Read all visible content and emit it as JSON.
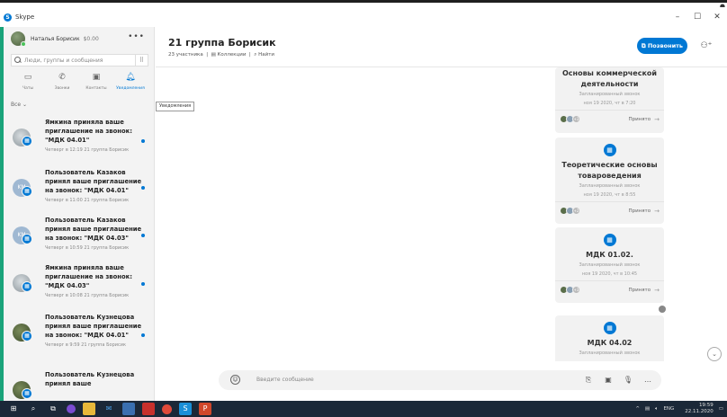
{
  "window": {
    "title": "Skype"
  },
  "profile": {
    "name": "Наталья Борисик",
    "balance": "$0.00"
  },
  "search": {
    "placeholder": "Люди, группы и сообщения"
  },
  "nav": [
    {
      "label": "Чаты",
      "icon": "chat-icon"
    },
    {
      "label": "Звонки",
      "icon": "phone-icon"
    },
    {
      "label": "Контакты",
      "icon": "contacts-icon"
    },
    {
      "label": "Уведомления",
      "icon": "bell-icon"
    }
  ],
  "filter": {
    "label": "Все"
  },
  "tooltip": "Уведомления",
  "notifications": [
    {
      "text": "Ямкина приняла ваше приглашение на звонок: \"МДК 04.01\"",
      "meta": "Четверг в 12:19  21 группа Борисик"
    },
    {
      "text": "Пользователь Казаков принял ваше приглашение на звонок: \"МДК 04.01\"",
      "meta": "Четверг в 11:00  21 группа Борисик",
      "initials": "KM"
    },
    {
      "text": "Пользователь Казаков принял ваше приглашение на звонок: \"МДК 04.03\"",
      "meta": "Четверг в 10:59  21 группа Борисик",
      "initials": "KM"
    },
    {
      "text": "Ямкина приняла ваше приглашение на звонок: \"МДК 04.03\"",
      "meta": "Четверг в 10:08  21 группа Борисик"
    },
    {
      "text": "Пользователь Кузнецова принял ваше приглашение на звонок: \"МДК 04.01\"",
      "meta": "Четверг в 9:59  21 группа Борисик"
    },
    {
      "text": "Пользователь Кузнецова принял ваше"
    }
  ],
  "chat": {
    "title": "21 группа Борисик",
    "participants": "23 участника",
    "collection": "Коллекции",
    "find": "Найти",
    "call_button": "Позвонить"
  },
  "cards": [
    {
      "title": "Основы коммерческой деятельности",
      "subtitle": "Запланированный звонок",
      "date": "ноя 19 2020, чт в 7:20",
      "count": "+3",
      "accepted": "Принято"
    },
    {
      "title": "Теоретические основы товароведения",
      "subtitle": "Запланированный звонок",
      "date": "ноя 19 2020, чт в 8:55",
      "count": "+2",
      "accepted": "Принято"
    },
    {
      "title": "МДК 01.02.",
      "subtitle": "Запланированный звонок",
      "date": "ноя 19 2020, чт в 10:45",
      "count": "+3",
      "accepted": "Принято"
    },
    {
      "title": "МДК 04.02",
      "subtitle": "Запланированный звонок"
    }
  ],
  "composer": {
    "placeholder": "Введите сообщение"
  },
  "taskbar": {
    "lang": "ENG",
    "time": "19:59",
    "date": "22.11.2020"
  },
  "colors": {
    "accent": "#0078d4",
    "left_strip": "#1aa37a",
    "taskbar": "#1b2838"
  }
}
